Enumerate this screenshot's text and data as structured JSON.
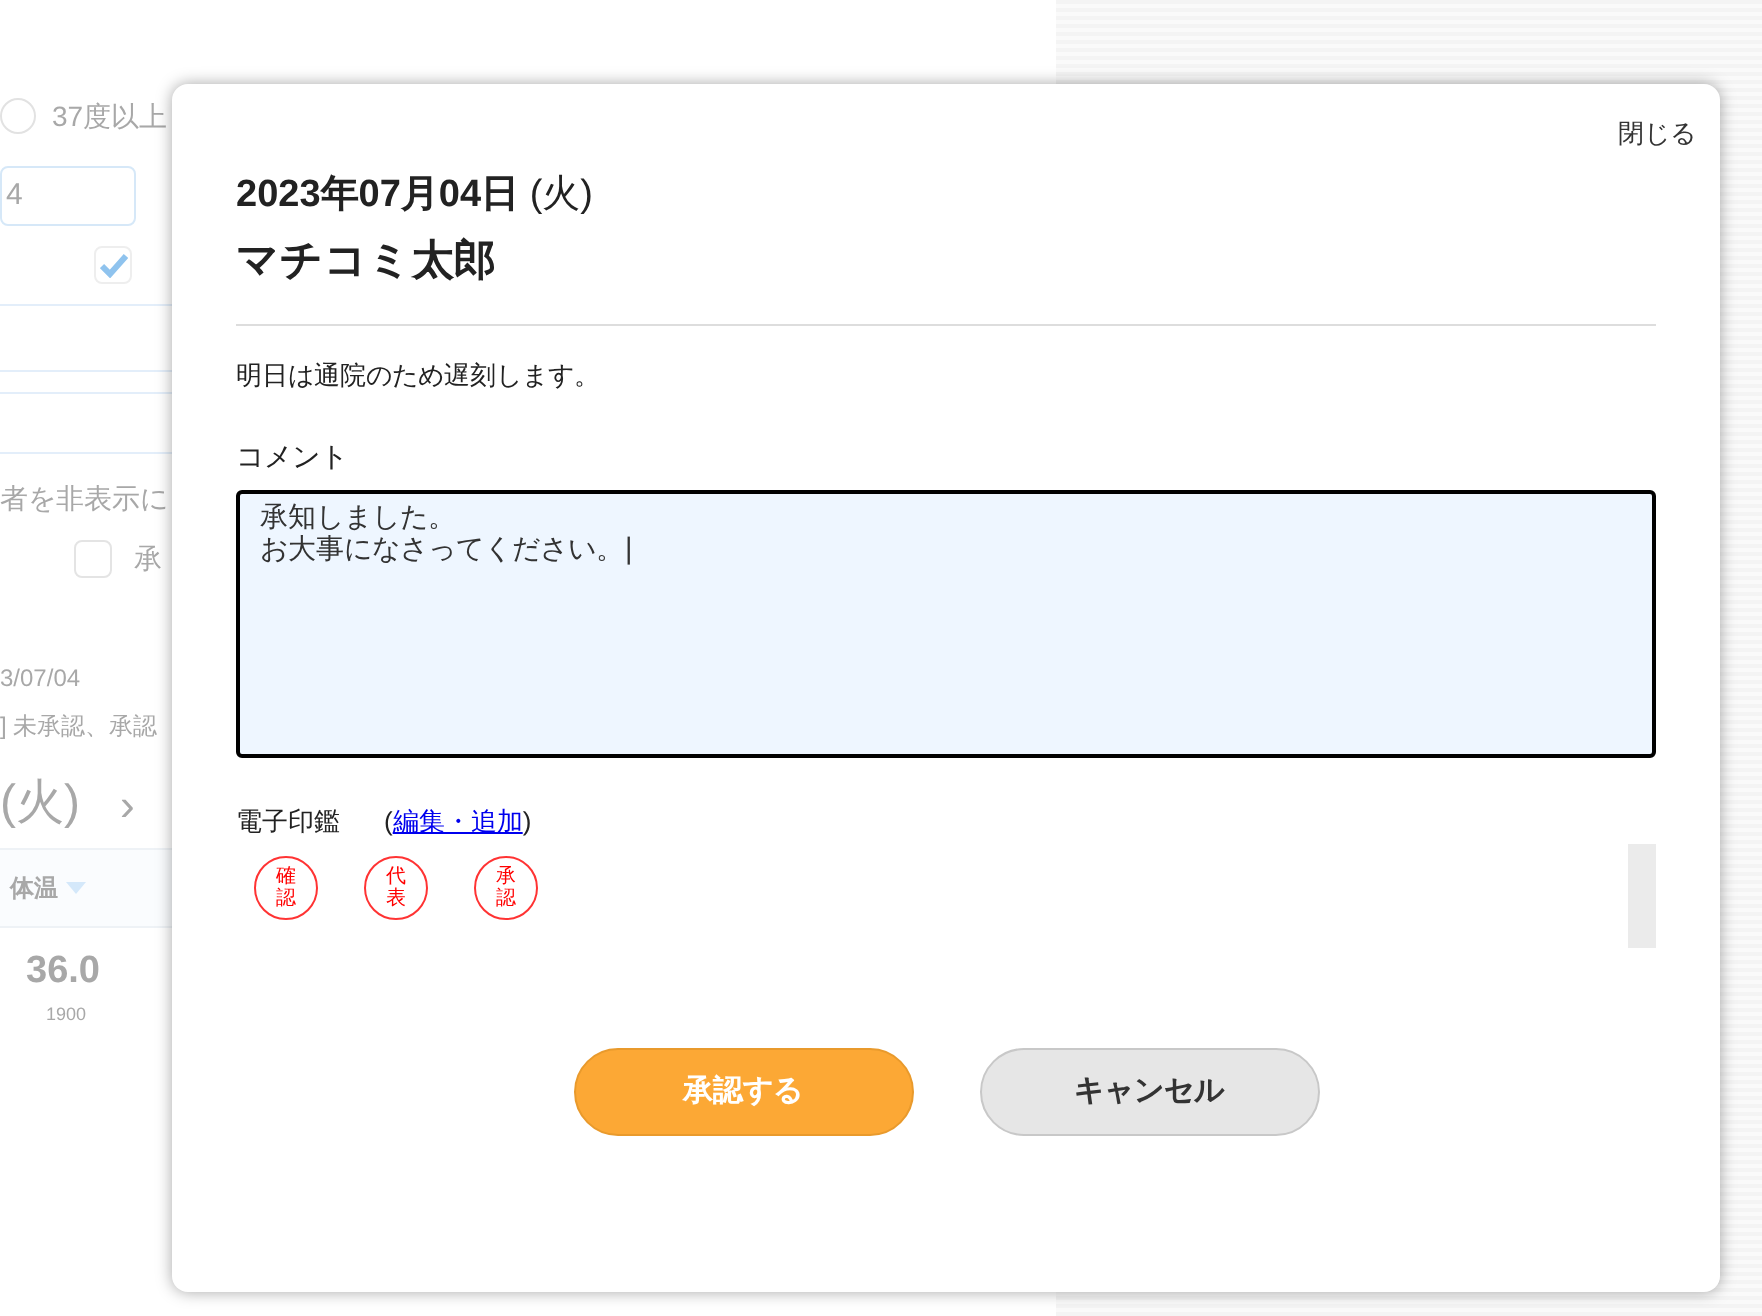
{
  "background": {
    "temp_option": {
      "label": "37度以上",
      "selected": false
    },
    "date_field": {
      "value": "4"
    },
    "checkbox_1": {
      "checked": true
    },
    "hide_text": "者を非表示に",
    "checkbox_2": {
      "checked": false,
      "label": "承"
    },
    "record_date": "3/07/04",
    "status_text": "] 未承認、承認",
    "day": "(火)",
    "next": "›",
    "column": "体温",
    "temperature": "36.0",
    "time": "1900"
  },
  "modal": {
    "close": "閉じる",
    "date": "**2023年07月04日** (火)",
    "name": "マチコミ太郎",
    "message": "明日は通院のため遅刻します。",
    "comment_label": "コメント",
    "comment_lines": [
      "承知しました。",
      "お大事になさってください。|"
    ],
    "stamp_label": "電子印鑑",
    "edit_link_open": "(",
    "edit_link": "編集・追加",
    "edit_link_close": ")",
    "stamps": [
      {
        "text": "確認"
      },
      {
        "text": "代表"
      },
      {
        "text": "承認"
      }
    ],
    "buttons": [
      {
        "label": "承認する",
        "kind": "primary"
      },
      {
        "label": "キャンセル",
        "kind": "secondary"
      }
    ]
  }
}
